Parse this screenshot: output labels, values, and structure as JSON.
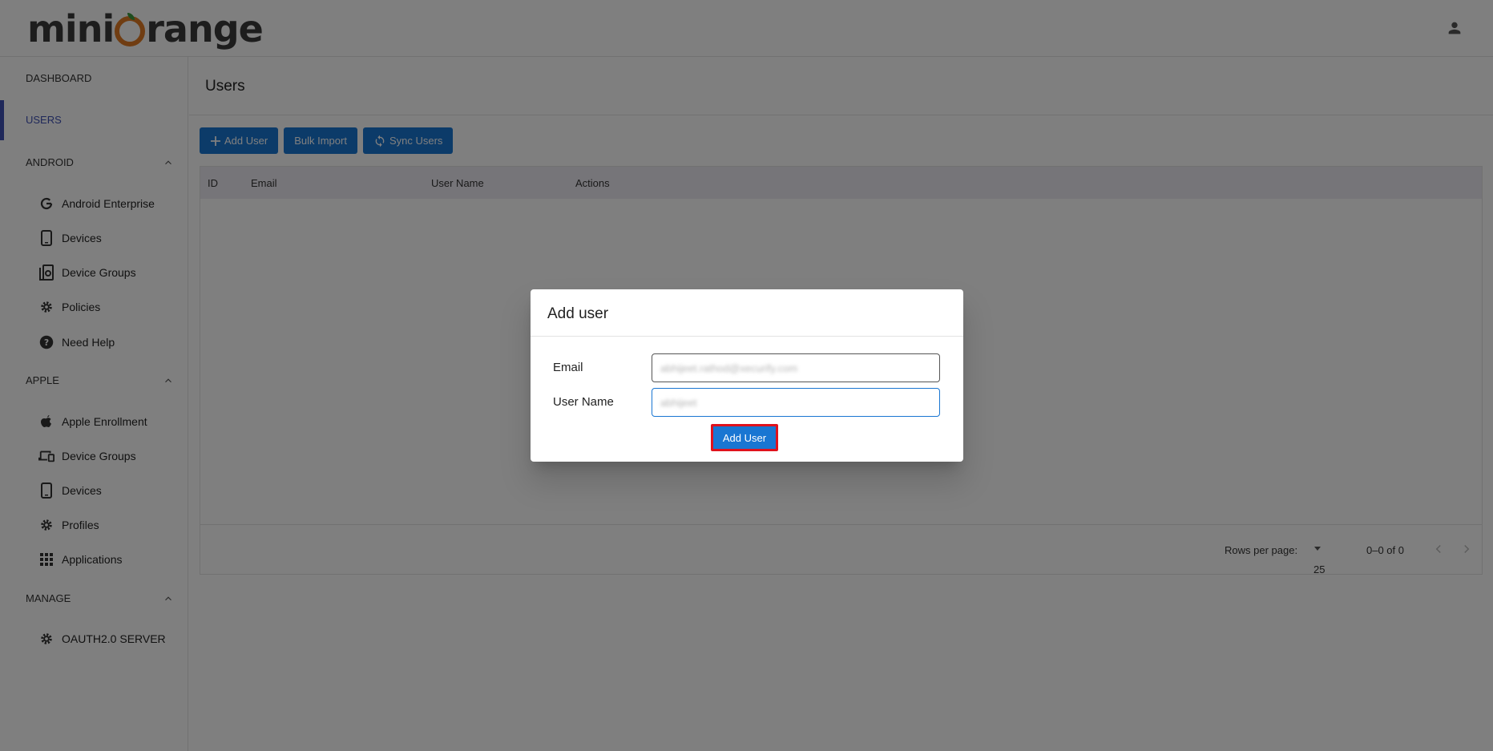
{
  "brand": {
    "logo_left": "mini",
    "logo_right": "range"
  },
  "sidebar": {
    "dashboard": "DASHBOARD",
    "users": "USERS",
    "android": {
      "title": "ANDROID",
      "items": [
        {
          "label": "Android Enterprise",
          "icon": "google-icon"
        },
        {
          "label": "Devices",
          "icon": "phone-icon"
        },
        {
          "label": "Device Groups",
          "icon": "device-groups-icon"
        },
        {
          "label": "Policies",
          "icon": "gear-icon"
        },
        {
          "label": "Need Help",
          "icon": "help-icon"
        }
      ]
    },
    "apple": {
      "title": "APPLE",
      "items": [
        {
          "label": "Apple Enrollment",
          "icon": "apple-icon"
        },
        {
          "label": "Device Groups",
          "icon": "devices-icon"
        },
        {
          "label": "Devices",
          "icon": "phone-icon"
        },
        {
          "label": "Profiles",
          "icon": "gear-icon"
        },
        {
          "label": "Applications",
          "icon": "apps-grid-icon"
        }
      ]
    },
    "manage": {
      "title": "MANAGE",
      "items": [
        {
          "label": "OAUTH2.0 SERVER",
          "icon": "gear-icon"
        }
      ]
    }
  },
  "page": {
    "title": "Users",
    "toolbar": {
      "add_user": "Add User",
      "bulk_import": "Bulk Import",
      "sync_users": "Sync Users"
    },
    "table": {
      "columns": [
        "ID",
        "Email",
        "User Name",
        "Actions"
      ],
      "rows": []
    },
    "pagination": {
      "rows_per_page_label": "Rows per page:",
      "rows_per_page_value": "25",
      "range": "0–0 of 0"
    }
  },
  "dialog": {
    "title": "Add user",
    "email_label": "Email",
    "email_value": "abhijeet.rathod@xecurify.com",
    "username_label": "User Name",
    "username_value": "abhijeet",
    "submit_label": "Add User"
  },
  "colors": {
    "primary": "#1976d2",
    "active_nav": "#3f51b5",
    "highlight_border": "#e0121c",
    "logo_orange": "#e07b24"
  }
}
